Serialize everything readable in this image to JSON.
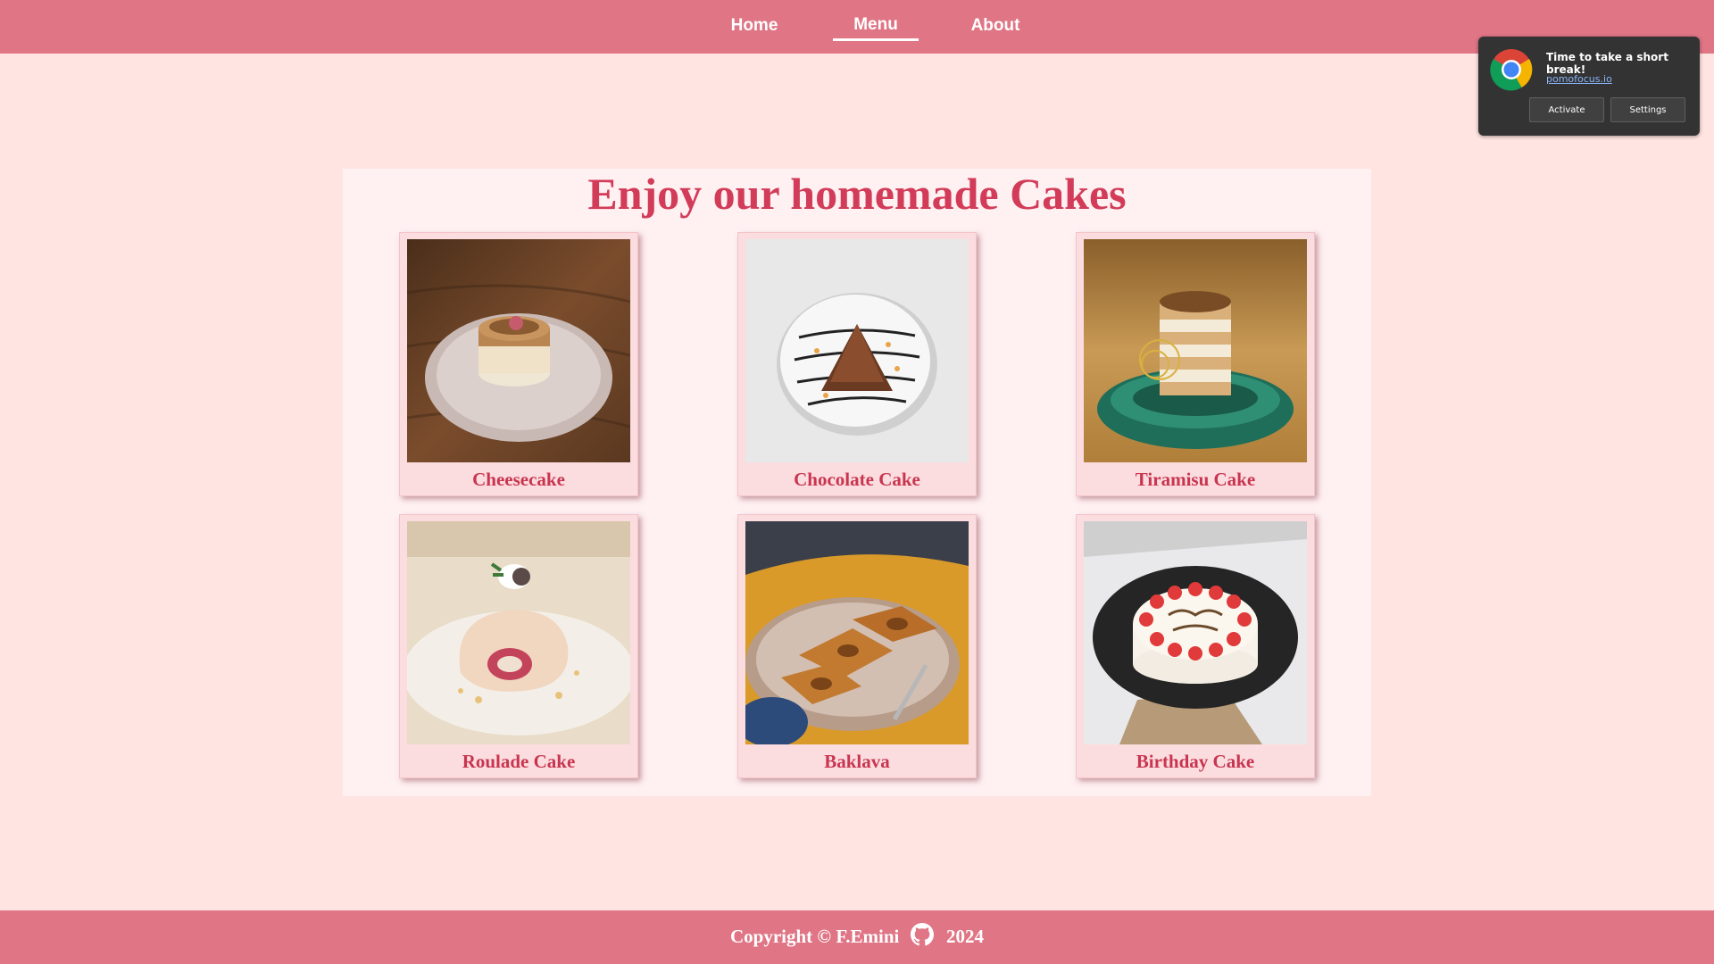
{
  "nav": {
    "items": [
      {
        "label": "Home"
      },
      {
        "label": "Menu"
      },
      {
        "label": "About"
      }
    ],
    "active": "Menu"
  },
  "main": {
    "title": "Enjoy our homemade Cakes",
    "cakes": [
      {
        "name": "Cheesecake"
      },
      {
        "name": "Chocolate Cake"
      },
      {
        "name": "Tiramisu Cake"
      },
      {
        "name": "Roulade Cake"
      },
      {
        "name": "Baklava"
      },
      {
        "name": "Birthday Cake"
      }
    ]
  },
  "footer": {
    "copyright": "Copyright © F.Emini",
    "year": "2024",
    "icon": "github-icon"
  },
  "notification": {
    "title": "Time to take a short break!",
    "link": "pomofocus.io",
    "buttons": [
      {
        "label": "Activate"
      },
      {
        "label": "Settings"
      }
    ],
    "icon": "chrome-icon"
  },
  "colors": {
    "accent": "#df7585",
    "title": "#d23c58",
    "background": "#ffe4e1"
  }
}
